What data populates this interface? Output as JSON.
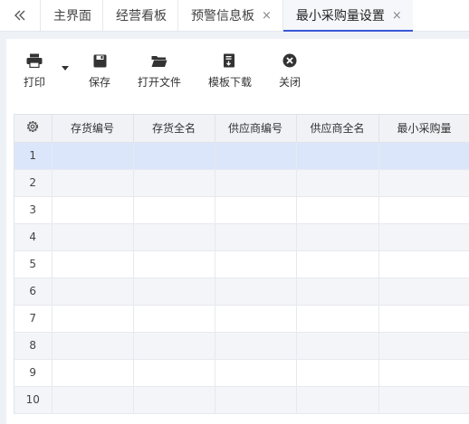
{
  "tabs": [
    {
      "label": "主界面",
      "closable": false
    },
    {
      "label": "经营看板",
      "closable": false
    },
    {
      "label": "预警信息板",
      "closable": true
    },
    {
      "label": "最小采购量设置",
      "closable": true,
      "active": true
    }
  ],
  "toolbar": {
    "print": "打印",
    "save": "保存",
    "open_file": "打开文件",
    "template_download": "模板下载",
    "close": "关闭"
  },
  "table": {
    "columns": [
      "存货编号",
      "存货全名",
      "供应商编号",
      "供应商全名",
      "最小采购量"
    ],
    "rows": [
      "1",
      "2",
      "3",
      "4",
      "5",
      "6",
      "7",
      "8",
      "9",
      "10"
    ],
    "selected_row": "1"
  },
  "colors": {
    "accent": "#3b5ad6",
    "selected_row": "#dce6fb"
  }
}
